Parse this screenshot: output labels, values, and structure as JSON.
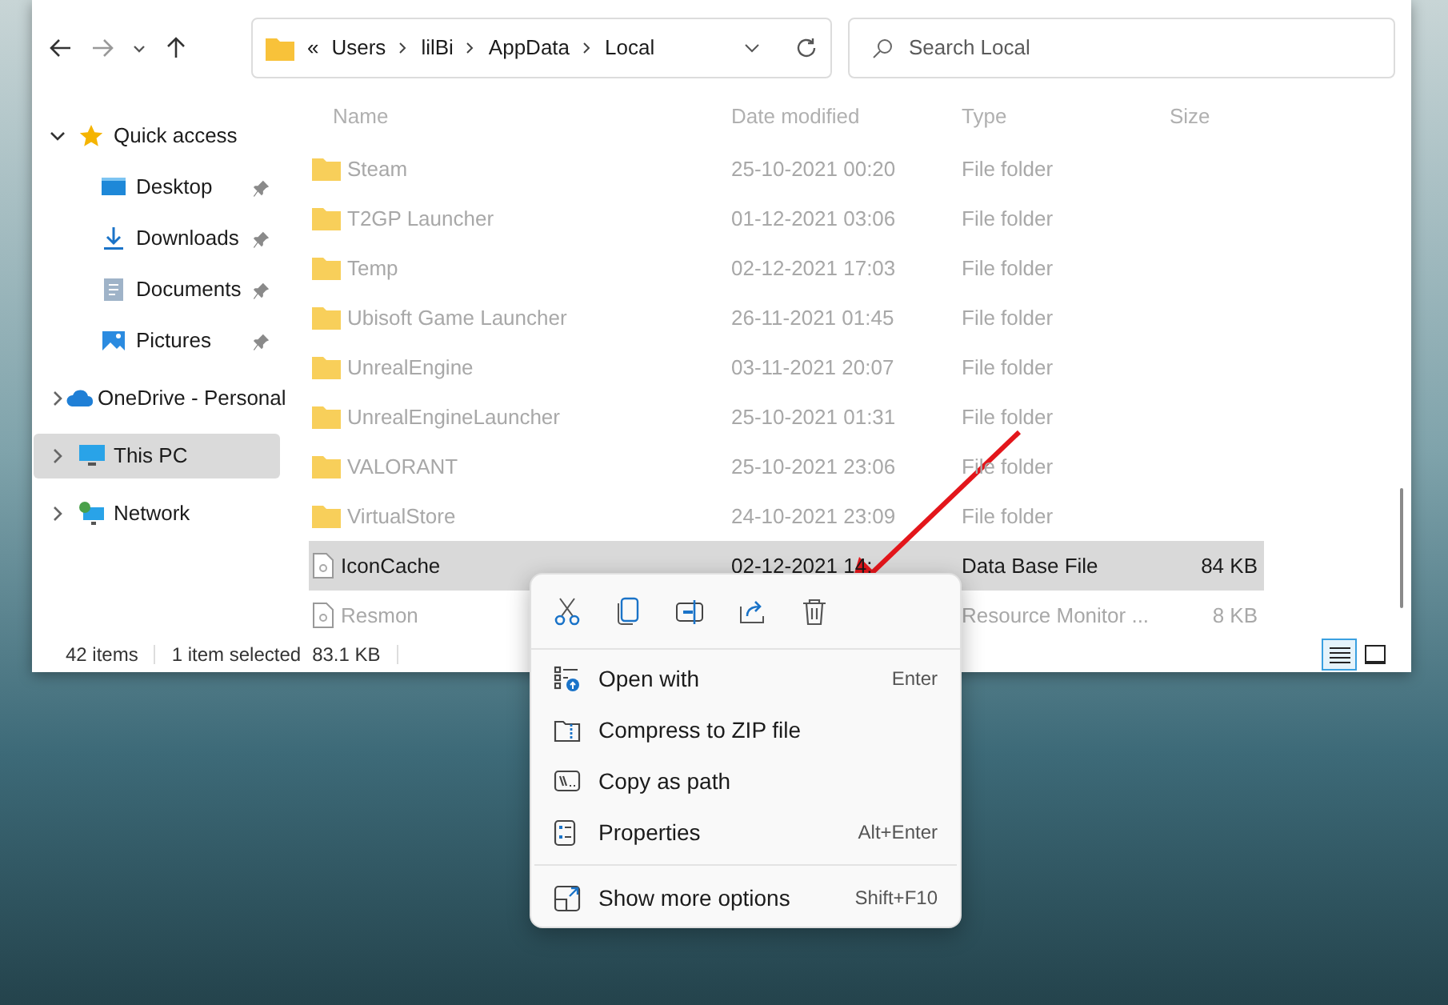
{
  "toolbar": {
    "address_overflow": "«",
    "path": [
      "Users",
      "lilBi",
      "AppData",
      "Local"
    ],
    "search": {
      "placeholder": "Search Local"
    }
  },
  "nav": [
    {
      "label": "Quick access",
      "kind": "star",
      "expanded": true,
      "selected": false,
      "children": [
        {
          "label": "Desktop",
          "kind": "desktop",
          "pinned": true,
          "selected": false
        },
        {
          "label": "Downloads",
          "kind": "download",
          "pinned": true,
          "selected": false
        },
        {
          "label": "Documents",
          "kind": "document",
          "pinned": true,
          "selected": false
        },
        {
          "label": "Pictures",
          "kind": "pictures",
          "pinned": true,
          "selected": false
        }
      ]
    },
    {
      "label": "OneDrive - Personal",
      "kind": "cloud",
      "expanded": false,
      "selected": false
    },
    {
      "label": "This PC",
      "kind": "pc",
      "expanded": false,
      "selected": true
    },
    {
      "label": "Network",
      "kind": "network",
      "expanded": false,
      "selected": false
    }
  ],
  "columns": [
    "Name",
    "Date modified",
    "Type",
    "Size"
  ],
  "rows": [
    {
      "kind": "folder",
      "name": "Steam",
      "date": "25-10-2021 00:20",
      "type": "File folder",
      "selected": false
    },
    {
      "kind": "folder",
      "name": "T2GP Launcher",
      "date": "01-12-2021 03:06",
      "type": "File folder",
      "selected": false
    },
    {
      "kind": "folder",
      "name": "Temp",
      "date": "02-12-2021 17:03",
      "type": "File folder",
      "selected": false
    },
    {
      "kind": "folder",
      "name": "Ubisoft Game Launcher",
      "date": "26-11-2021 01:45",
      "type": "File folder",
      "selected": false
    },
    {
      "kind": "folder",
      "name": "UnrealEngine",
      "date": "03-11-2021 20:07",
      "type": "File folder",
      "selected": false
    },
    {
      "kind": "folder",
      "name": "UnrealEngineLauncher",
      "date": "25-10-2021 01:31",
      "type": "File folder",
      "selected": false
    },
    {
      "kind": "folder",
      "name": "VALORANT",
      "date": "25-10-2021 23:06",
      "type": "File folder",
      "selected": false
    },
    {
      "kind": "folder",
      "name": "VirtualStore",
      "date": "24-10-2021 23:09",
      "type": "File folder",
      "selected": false
    },
    {
      "kind": "file",
      "name": "IconCache",
      "date": "02-12-2021 14:",
      "type": "Data Base File",
      "size": "84 KB",
      "selected": true
    },
    {
      "kind": "file",
      "name": "Resmon",
      "type": "Resource Monitor ...",
      "size": "8 KB",
      "selected": false
    }
  ],
  "status_bar": {
    "count": "42 items",
    "selection": "1 item selected",
    "size": "83.1 KB",
    "views": [
      {
        "kind": "details",
        "selected": true
      },
      {
        "kind": "tiles",
        "selected": false
      }
    ]
  },
  "context_menu": {
    "items": [
      {
        "kind": "open_with",
        "label": "Open with",
        "shortcut": "Enter",
        "separator_before": false
      },
      {
        "kind": "zip",
        "label": "Compress to ZIP file",
        "separator_before": false
      },
      {
        "kind": "path",
        "label": "Copy as path",
        "separator_before": false
      },
      {
        "kind": "properties",
        "label": "Properties",
        "shortcut": "Alt+Enter",
        "separator_before": false
      },
      {
        "kind": "more",
        "label": "Show more options",
        "shortcut": "Shift+F10",
        "separator_before": true
      }
    ]
  }
}
